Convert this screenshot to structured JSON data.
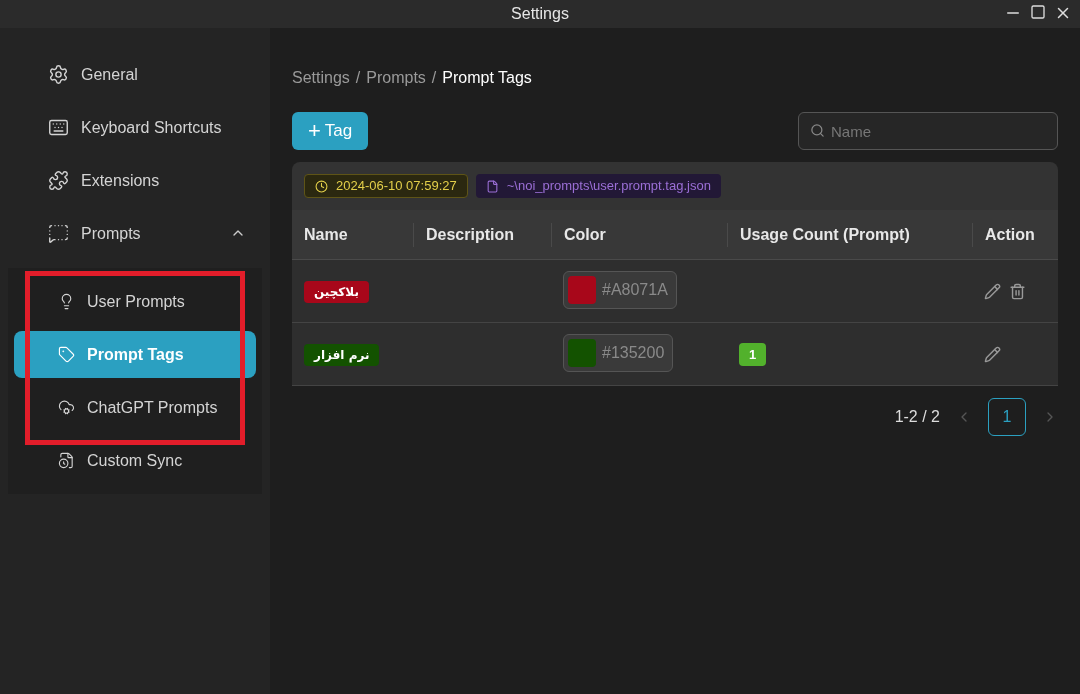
{
  "window": {
    "title": "Settings"
  },
  "sidebar": {
    "items": [
      {
        "label": "General",
        "selected": false
      },
      {
        "label": "Keyboard Shortcuts",
        "selected": false
      },
      {
        "label": "Extensions",
        "selected": false
      },
      {
        "label": "Prompts",
        "selected": false,
        "expanded": true,
        "children": [
          {
            "label": "User Prompts",
            "selected": false
          },
          {
            "label": "Prompt Tags",
            "selected": true
          },
          {
            "label": "ChatGPT Prompts",
            "selected": false
          },
          {
            "label": "Custom Sync",
            "selected": false
          }
        ]
      }
    ]
  },
  "breadcrumb": {
    "items": [
      "Settings",
      "Prompts",
      "Prompt Tags"
    ],
    "separator": "/"
  },
  "add_button": {
    "icon": "+",
    "label": "Tag"
  },
  "search": {
    "placeholder": "Name"
  },
  "info": {
    "time": "2024-06-10 07:59:27",
    "path": "~\\noi_prompts\\user.prompt.tag.json"
  },
  "table": {
    "columns": [
      "Name",
      "Description",
      "Color",
      "Usage Count (Prompt)",
      "Action"
    ],
    "rows": [
      {
        "name": "بلاکچین",
        "color": "#a8071a",
        "hex": "#A8071A",
        "deletable": true
      },
      {
        "name": "نرم افزار",
        "color": "#135200",
        "hex": "#135200",
        "count": "1",
        "deletable": false
      }
    ]
  },
  "pagination": {
    "range": "1-2 / 2",
    "pages": [
      {
        "label": "1",
        "selected": true
      }
    ]
  }
}
